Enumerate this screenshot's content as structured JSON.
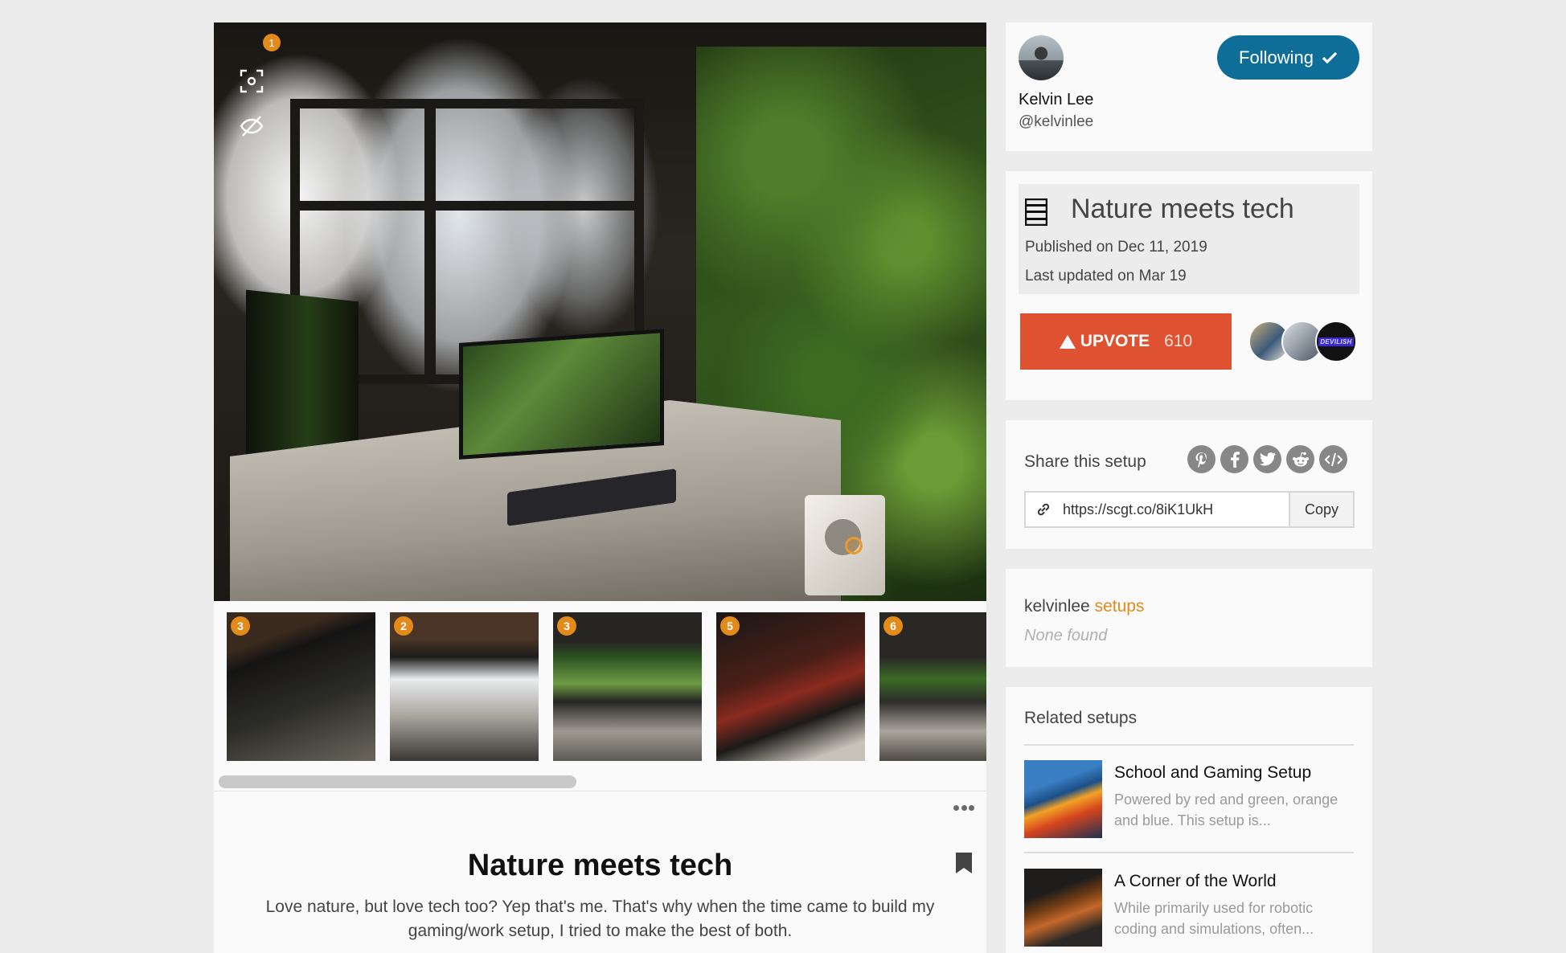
{
  "hero": {
    "tool_badge": "1",
    "hotspot_icon": "circle-hotspot-icon"
  },
  "thumbnails": [
    {
      "badge": "3"
    },
    {
      "badge": "2"
    },
    {
      "badge": "3"
    },
    {
      "badge": "5"
    },
    {
      "badge": "6"
    }
  ],
  "post": {
    "title": "Nature meets tech",
    "description": "Love nature, but love tech too? Yep that's me. That's why when the time came to build my gaming/work setup, I tried to make the best of both."
  },
  "profile": {
    "name": "Kelvin Lee",
    "handle": "@kelvinlee",
    "follow_label": "Following"
  },
  "info": {
    "title": "Nature meets tech",
    "published": "Published on Dec 11, 2019",
    "updated": "Last updated on Mar 19",
    "upvote_label": "UPVOTE",
    "upvote_count": "610",
    "voter3_text": "DEVILISH"
  },
  "share": {
    "label": "Share this setup",
    "icons": [
      "pinterest-icon",
      "facebook-icon",
      "twitter-icon",
      "reddit-icon",
      "embed-code-icon"
    ],
    "url": "https://scgt.co/8iK1UkH",
    "copy_label": "Copy"
  },
  "setups": {
    "user": "kelvinlee",
    "accent": "setups",
    "empty": "None found"
  },
  "related": {
    "title": "Related setups",
    "items": [
      {
        "name": "School and Gaming Setup",
        "desc": "Powered by red and green, orange and blue. This setup is..."
      },
      {
        "name": "A Corner of the World",
        "desc": "While primarily used for robotic coding and simulations, often..."
      }
    ]
  },
  "colors": {
    "follow": "#0e6e97",
    "upvote": "#de5232",
    "accent": "#e28a1a"
  }
}
